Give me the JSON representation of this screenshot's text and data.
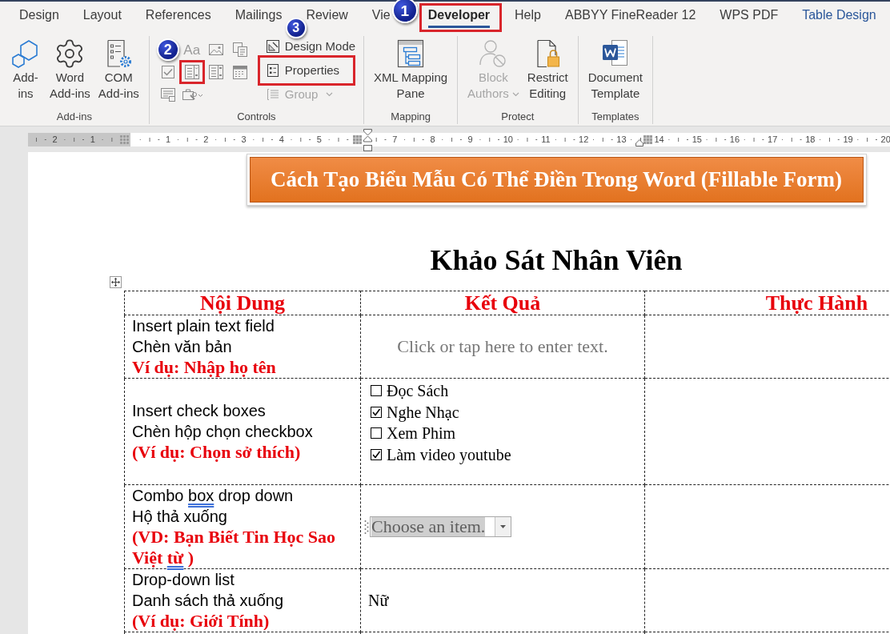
{
  "ribbon": {
    "tabs": [
      {
        "label": "Design",
        "kind": "normal",
        "selected": false,
        "highlighted": false
      },
      {
        "label": "Layout",
        "kind": "normal",
        "selected": false,
        "highlighted": false
      },
      {
        "label": "References",
        "kind": "normal",
        "selected": false,
        "highlighted": false
      },
      {
        "label": "Mailings",
        "kind": "normal",
        "selected": false,
        "highlighted": false
      },
      {
        "label": "Review",
        "kind": "normal",
        "selected": false,
        "highlighted": false
      },
      {
        "label": "Vie",
        "kind": "normal",
        "selected": false,
        "highlighted": false
      },
      {
        "label": "Developer",
        "kind": "normal",
        "selected": true,
        "highlighted": true,
        "badge": "1"
      },
      {
        "label": "Help",
        "kind": "normal",
        "selected": false,
        "highlighted": false
      },
      {
        "label": "ABBYY FineReader 12",
        "kind": "normal",
        "selected": false,
        "highlighted": false
      },
      {
        "label": "WPS PDF",
        "kind": "normal",
        "selected": false,
        "highlighted": false
      },
      {
        "label": "Table Design",
        "kind": "contextual",
        "selected": false,
        "highlighted": false
      }
    ],
    "groups": [
      {
        "label": "Add-ins",
        "kind": "large",
        "buttons": [
          {
            "kind": "addins",
            "lines": [
              "Add-",
              "ins"
            ],
            "disabled": false,
            "menu": false
          },
          {
            "kind": "word_addins",
            "lines": [
              "Word",
              "Add-ins"
            ],
            "disabled": false,
            "menu": false
          },
          {
            "kind": "com_addins",
            "lines": [
              "COM",
              "Add-ins"
            ],
            "disabled": false,
            "menu": false
          }
        ]
      },
      {
        "label": "Controls",
        "kind": "controls",
        "control_rows": [
          [
            {
              "kind": "step_badge",
              "badge": "2"
            },
            {
              "kind": "plain_text",
              "glyph": "Aa",
              "highlighted": false
            },
            {
              "kind": "picture",
              "highlighted": false
            },
            {
              "kind": "building_block",
              "highlighted": false
            }
          ],
          [
            {
              "kind": "checkbox",
              "highlighted": false
            },
            {
              "kind": "combo",
              "highlighted": true
            },
            {
              "kind": "dropdown",
              "highlighted": false
            },
            {
              "kind": "date",
              "highlighted": false
            }
          ],
          [
            {
              "kind": "repeating",
              "highlighted": false
            },
            {
              "kind": "legacy",
              "highlighted": false
            }
          ]
        ],
        "commands": [
          {
            "kind": "design_mode",
            "label": "Design Mode",
            "disabled": false,
            "menu": false,
            "highlighted": false
          },
          {
            "kind": "properties",
            "label": "Properties",
            "disabled": false,
            "menu": false,
            "highlighted": true,
            "badge": "3"
          },
          {
            "kind": "group",
            "label": "Group",
            "disabled": true,
            "menu": true,
            "highlighted": false
          }
        ]
      },
      {
        "label": "Mapping",
        "kind": "large",
        "buttons": [
          {
            "kind": "xml",
            "lines": [
              "XML Mapping",
              "Pane"
            ],
            "disabled": false,
            "menu": false
          }
        ]
      },
      {
        "label": "Protect",
        "kind": "large",
        "buttons": [
          {
            "kind": "block_authors",
            "lines": [
              "Block",
              "Authors"
            ],
            "disabled": true,
            "menu": true
          },
          {
            "kind": "restrict",
            "lines": [
              "Restrict",
              "Editing"
            ],
            "disabled": false,
            "menu": false
          }
        ]
      },
      {
        "label": "Templates",
        "kind": "large",
        "buttons": [
          {
            "kind": "template",
            "lines": [
              "Document",
              "Template"
            ],
            "disabled": false,
            "menu": false
          }
        ]
      }
    ]
  },
  "ruler": {
    "marks": [
      {
        "kind": "margin",
        "label": "2"
      },
      {
        "kind": "margin",
        "label": "1"
      },
      {
        "kind": "origin"
      },
      {
        "kind": "number",
        "label": "1"
      },
      {
        "kind": "number",
        "label": "2"
      },
      {
        "kind": "number",
        "label": "3"
      },
      {
        "kind": "number",
        "label": "4"
      },
      {
        "kind": "number",
        "label": "5"
      },
      {
        "kind": "indent"
      },
      {
        "kind": "number",
        "label": "7"
      },
      {
        "kind": "number",
        "label": "8"
      },
      {
        "kind": "number",
        "label": "9"
      },
      {
        "kind": "number",
        "label": "10"
      },
      {
        "kind": "number",
        "label": "11"
      },
      {
        "kind": "number",
        "label": "12"
      },
      {
        "kind": "number",
        "label": "13"
      },
      {
        "kind": "edge",
        "label": "14"
      },
      {
        "kind": "number",
        "label": "15"
      },
      {
        "kind": "number",
        "label": "16"
      },
      {
        "kind": "number",
        "label": "17"
      },
      {
        "kind": "number",
        "label": "18"
      },
      {
        "kind": "number",
        "label": "19"
      },
      {
        "kind": "number",
        "label": "20"
      }
    ]
  },
  "document": {
    "banner": "Cách Tạo Biểu Mẫu Có Thể Điền Trong Word (Fillable Form)",
    "heading": "Khảo Sát Nhân Viên",
    "table": {
      "columns": [
        "Nội Dung",
        "Kết Quả",
        "Thực Hành"
      ],
      "rows": [
        {
          "description": [
            {
              "kind": "plain",
              "text": "Insert plain text field"
            },
            {
              "kind": "plain",
              "text": "Chèn văn bản"
            },
            {
              "kind": "example",
              "text": "Ví dụ: Nhập họ tên"
            }
          ],
          "result": {
            "kind": "text_field",
            "placeholder": "Click or tap here to enter text."
          }
        },
        {
          "description": [
            {
              "kind": "plain",
              "text": "Insert check boxes"
            },
            {
              "kind": "plain",
              "text": "Chèn hộp chọn checkbox"
            },
            {
              "kind": "example",
              "text": "(Ví dụ: Chọn sở thích)"
            }
          ],
          "result": {
            "kind": "checkboxes",
            "options": [
              {
                "label": "Đọc Sách",
                "checked": false
              },
              {
                "label": "Nghe Nhạc",
                "checked": true
              },
              {
                "label": "Xem Phim",
                "checked": false
              },
              {
                "label": "Làm video youtube",
                "checked": true
              }
            ]
          }
        },
        {
          "description": [
            {
              "kind": "plain",
              "parts": [
                {
                  "text": "Combo ",
                  "flagged": false
                },
                {
                  "text": "box",
                  "flagged": true
                },
                {
                  "text": " drop down",
                  "flagged": false
                }
              ]
            },
            {
              "kind": "plain",
              "text": "Hộ thả xuống"
            },
            {
              "kind": "example",
              "parts": [
                {
                  "text": "(VD: Bạn Biết Tin Học Sao Việt ",
                  "flagged": false
                },
                {
                  "text": "từ",
                  "flagged": true
                },
                {
                  "text": " )",
                  "flagged": false
                }
              ]
            }
          ],
          "result": {
            "kind": "combo",
            "placeholder": "Choose an item."
          }
        },
        {
          "description": [
            {
              "kind": "plain",
              "text": "Drop-down list"
            },
            {
              "kind": "plain",
              "text": "Danh sách thả xuống"
            },
            {
              "kind": "example",
              "text": "(Ví dụ: Giới Tính)"
            }
          ],
          "result": {
            "kind": "dropdown",
            "value": "Nữ"
          }
        }
      ]
    }
  }
}
